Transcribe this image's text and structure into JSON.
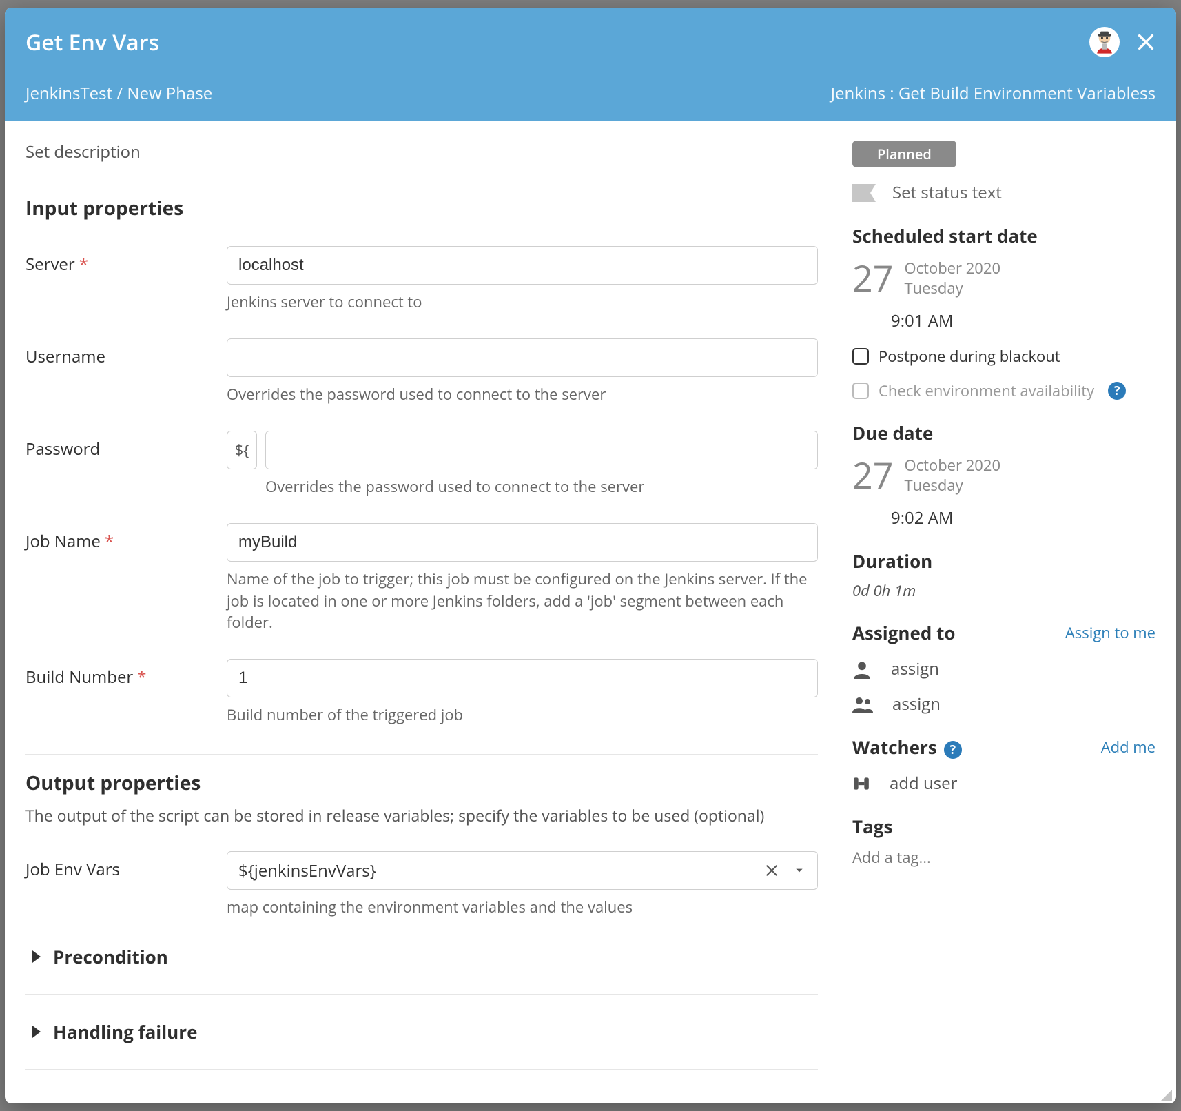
{
  "header": {
    "title": "Get Env Vars",
    "breadcrumb": "JenkinsTest / New Phase",
    "task_type": "Jenkins : Get Build Environment Variabless"
  },
  "main": {
    "set_description": "Set description",
    "input_section": "Input properties",
    "output_section": "Output properties",
    "output_help": "The output of the script can be stored in release variables; specify the variables to be used (optional)",
    "fields": {
      "server": {
        "label": "Server",
        "value": "localhost",
        "hint": "Jenkins server to connect to",
        "required": true
      },
      "username": {
        "label": "Username",
        "value": "",
        "hint": "Overrides the password used to connect to the server",
        "required": false
      },
      "password": {
        "label": "Password",
        "value": "",
        "hint": "Overrides the password used to connect to the server",
        "required": false,
        "var_btn": "${"
      },
      "job_name": {
        "label": "Job Name",
        "value": "myBuild",
        "hint": "Name of the job to trigger; this job must be configured on the Jenkins server. If the job is located in one or more Jenkins folders, add a 'job' segment between each folder.",
        "required": true
      },
      "build_number": {
        "label": "Build Number",
        "value": "1",
        "hint": "Build number of the triggered job",
        "required": true
      },
      "job_env_vars": {
        "label": "Job Env Vars",
        "value": "${jenkinsEnvVars}",
        "hint": "map containing the environment variables and the values"
      }
    },
    "expanders": {
      "precondition": "Precondition",
      "handling_failure": "Handling failure"
    }
  },
  "side": {
    "status_badge": "Planned",
    "status_text_placeholder": "Set status text",
    "scheduled": {
      "heading": "Scheduled start date",
      "day": "27",
      "month_year": "October 2020",
      "weekday": "Tuesday",
      "time": "9:01 AM"
    },
    "postpone": "Postpone during blackout",
    "check_env": "Check environment availability",
    "due": {
      "heading": "Due date",
      "day": "27",
      "month_year": "October 2020",
      "weekday": "Tuesday",
      "time": "9:02 AM"
    },
    "duration": {
      "heading": "Duration",
      "value": "0d 0h 1m"
    },
    "assigned": {
      "heading": "Assigned to",
      "assign_to_me": "Assign to me",
      "user_placeholder": "assign",
      "team_placeholder": "assign"
    },
    "watchers": {
      "heading": "Watchers",
      "add_me": "Add me",
      "add_user": "add user"
    },
    "tags": {
      "heading": "Tags",
      "placeholder": "Add a tag..."
    }
  }
}
